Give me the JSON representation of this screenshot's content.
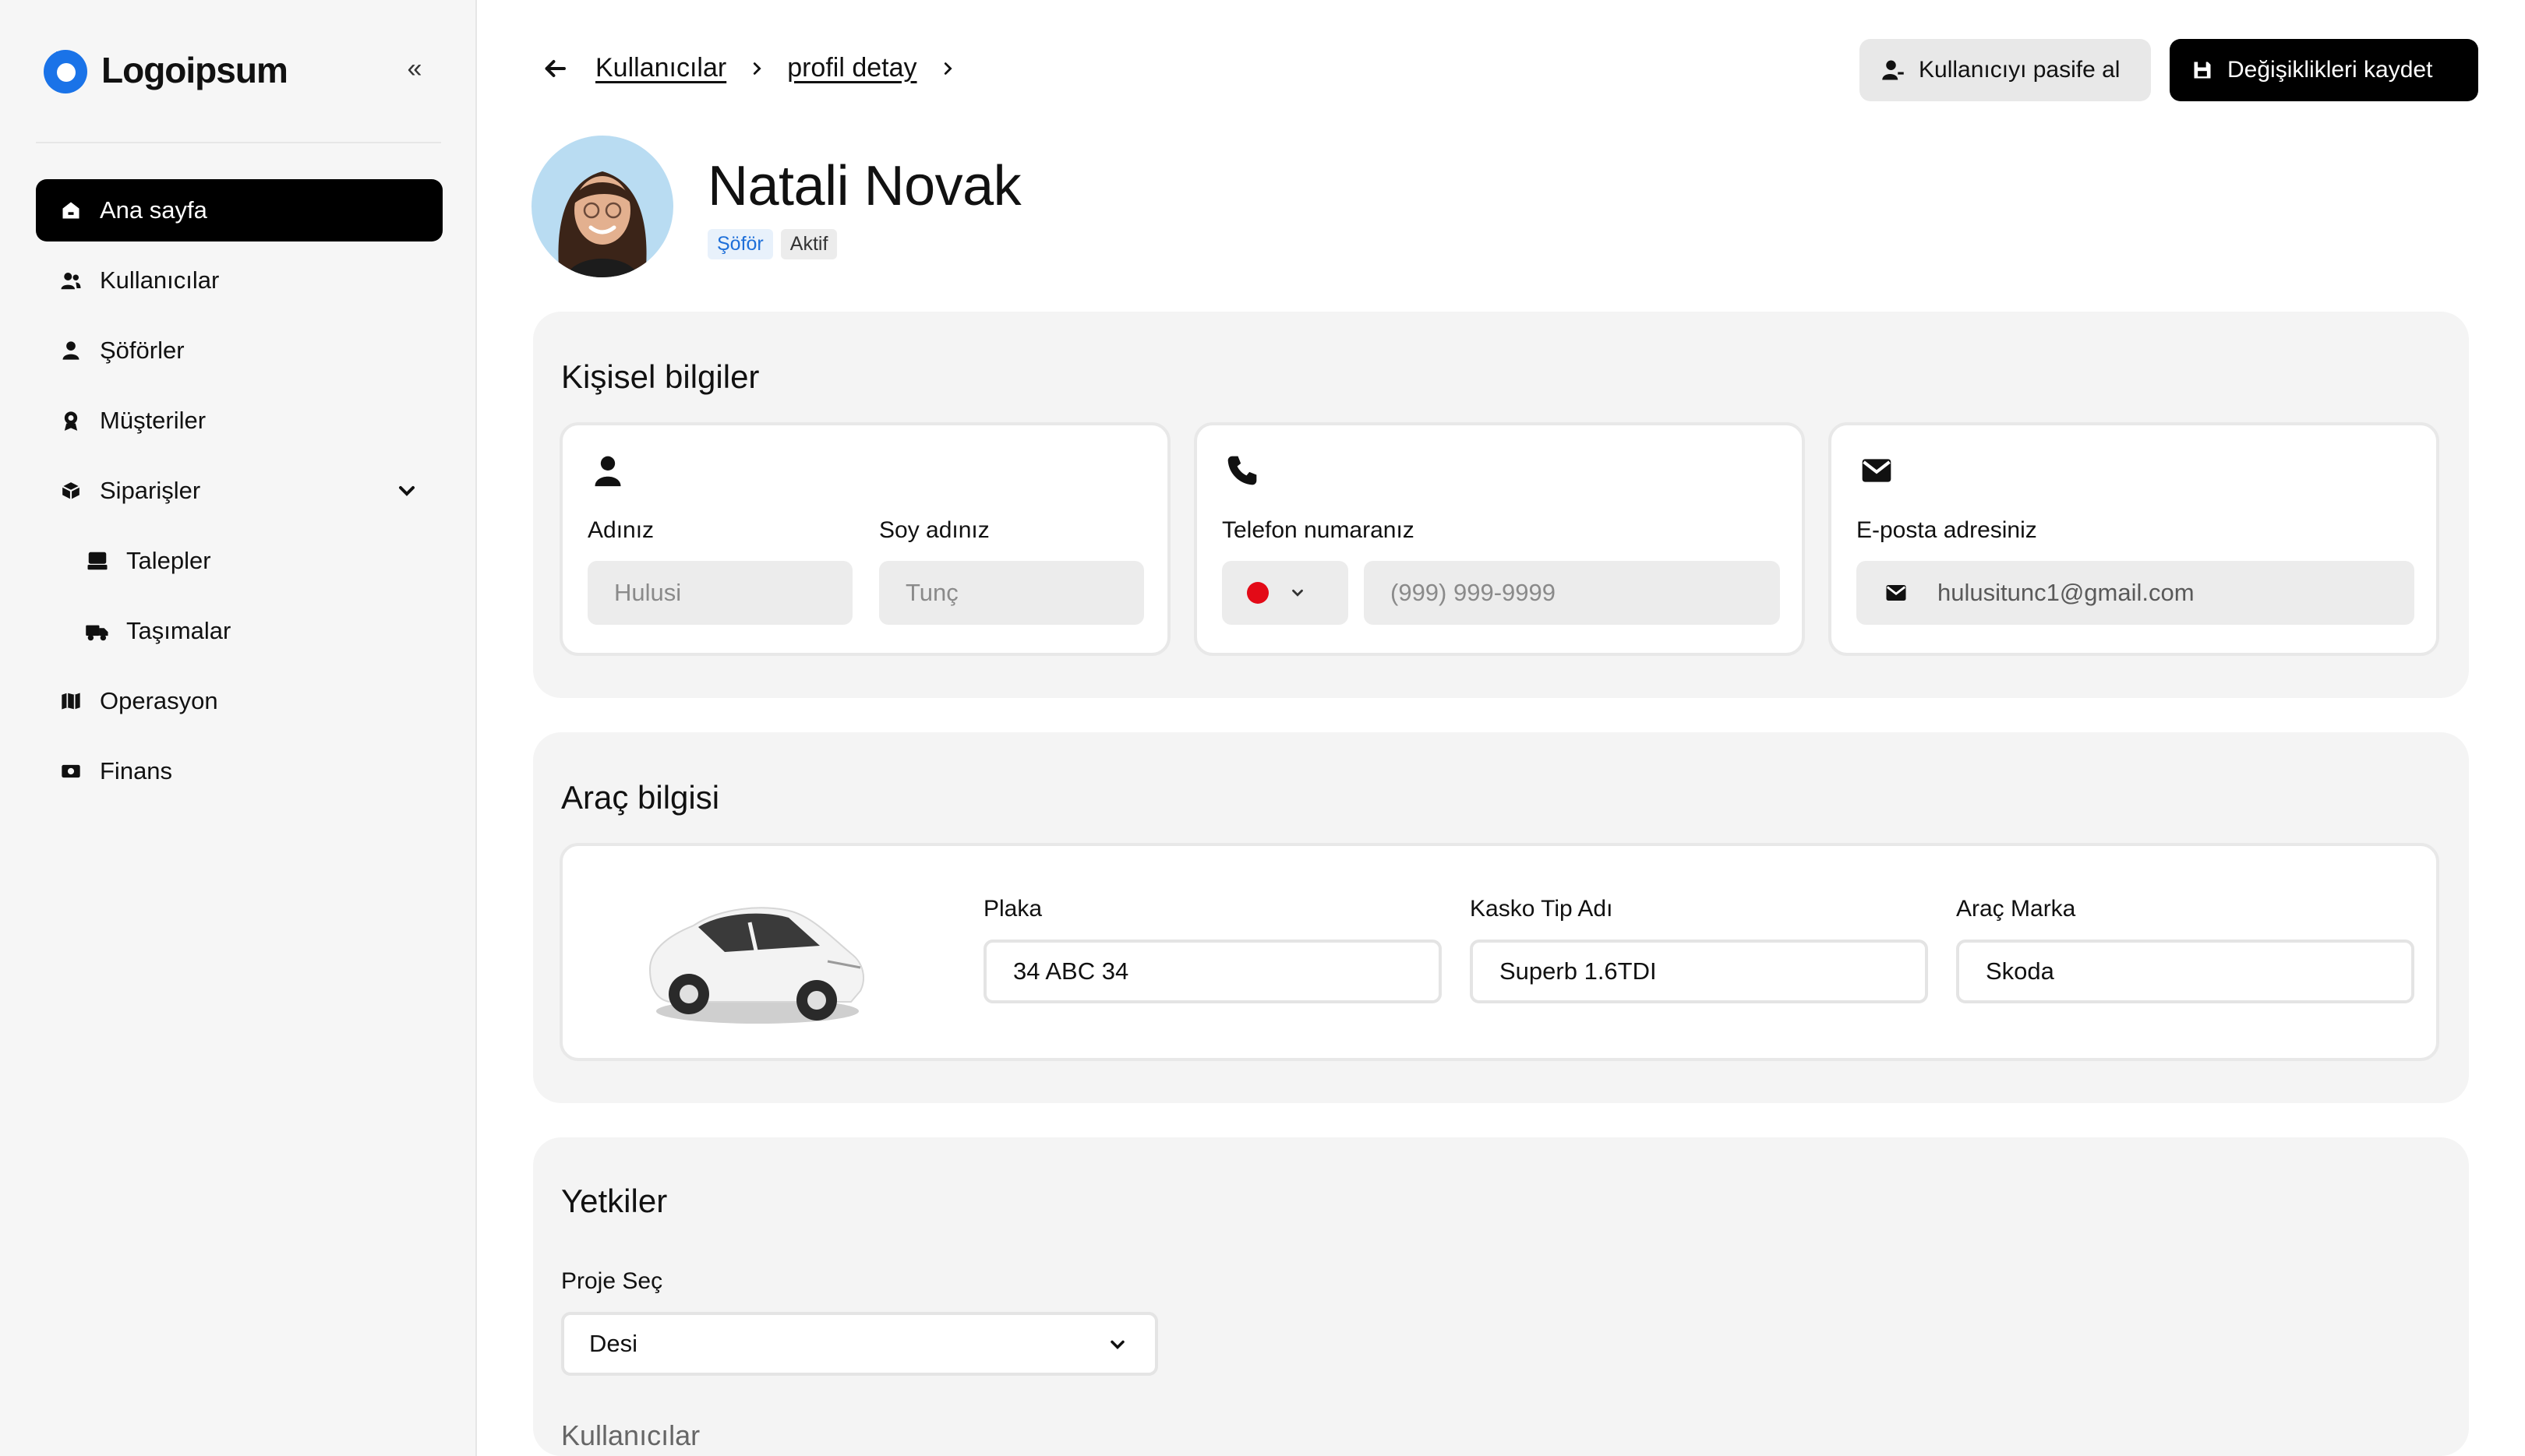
{
  "brand": {
    "name": "Logoipsum",
    "collapse_icon": "«"
  },
  "sidebar": {
    "items": [
      {
        "label": "Ana sayfa",
        "icon": "home-icon",
        "active": true
      },
      {
        "label": "Kullanıcılar",
        "icon": "users-icon"
      },
      {
        "label": "Şöförler",
        "icon": "person-icon"
      },
      {
        "label": "Müşteriler",
        "icon": "badge-icon"
      },
      {
        "label": "Siparişler",
        "icon": "box-icon",
        "expandable": true
      },
      {
        "label": "Talepler",
        "icon": "tray-icon",
        "sub": true
      },
      {
        "label": "Taşımalar",
        "icon": "truck-icon",
        "sub": true
      },
      {
        "label": "Operasyon",
        "icon": "map-icon"
      },
      {
        "label": "Finans",
        "icon": "money-icon"
      }
    ]
  },
  "breadcrumb": {
    "items": [
      "Kullanıcılar",
      "profil detay"
    ]
  },
  "actions": {
    "deactivate_label": "Kullanıcıyı pasife al",
    "save_label": "Değişiklikleri kaydet"
  },
  "profile": {
    "name": "Natali Novak",
    "role": "Şöför",
    "status": "Aktif"
  },
  "personal": {
    "title": "Kişisel bilgiler",
    "first_name_label": "Adınız",
    "first_name_placeholder": "Hulusi",
    "last_name_label": "Soy adınız",
    "last_name_placeholder": "Tunç",
    "phone_label": "Telefon numaranız",
    "phone_placeholder": "(999) 999-9999",
    "email_label": "E-posta adresiniz",
    "email_value": "hulusitunc1@gmail.com"
  },
  "vehicle": {
    "title": "Araç bilgisi",
    "plate_label": "Plaka",
    "plate_value": "34 ABC 34",
    "insurance_label": "Kasko Tip Adı",
    "insurance_value": "Superb 1.6TDI",
    "brand_label": "Araç Marka",
    "brand_value": "Skoda"
  },
  "permissions": {
    "title": "Yetkiler",
    "project_label": "Proje Seç",
    "project_value": "Desi",
    "users_label": "Kullanıcılar"
  },
  "colors": {
    "accent": "#1e6fd9",
    "logo": "#1a73e8",
    "flag": "#e30a17"
  }
}
